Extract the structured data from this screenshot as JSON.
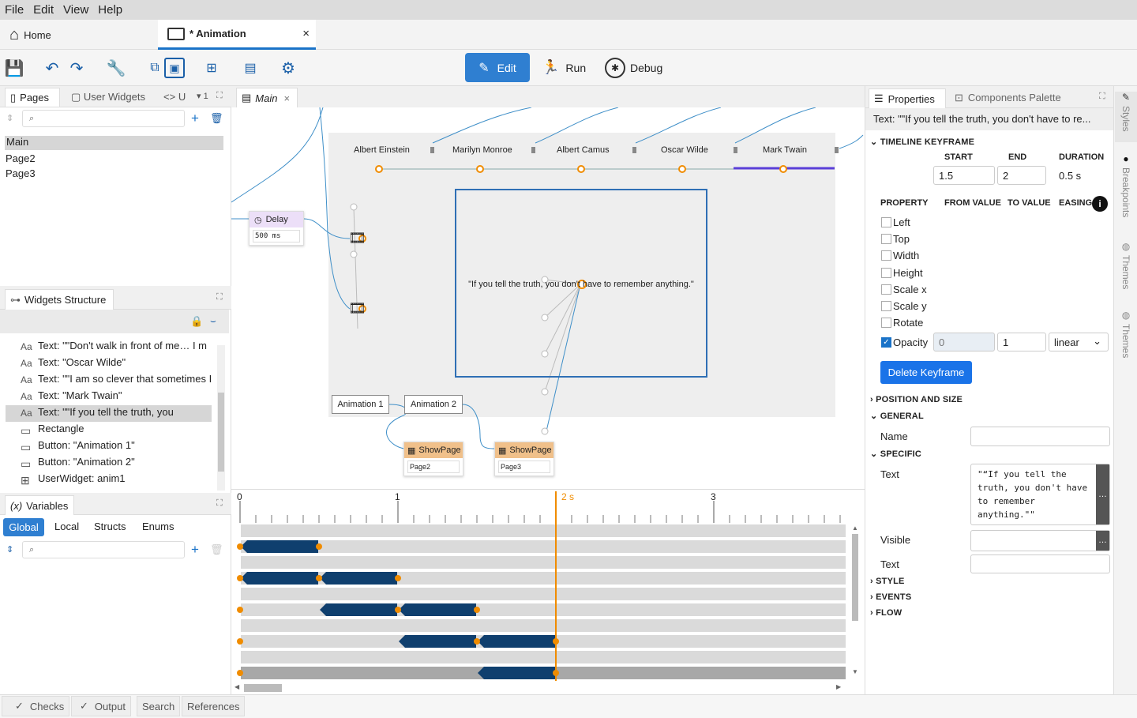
{
  "menu": [
    "File",
    "Edit",
    "View",
    "Help"
  ],
  "tabs": {
    "home": "Home",
    "animation": "* Animation"
  },
  "toolbar": {
    "edit": "Edit",
    "run": "Run",
    "debug": "Debug"
  },
  "left": {
    "pages_tab": "Pages",
    "user_widgets_tab": "User Widgets",
    "u_tab": "U",
    "count": "1",
    "pages": [
      "Main",
      "Page2",
      "Page3"
    ],
    "widgets_title": "Widgets Structure",
    "widgets": [
      "Text: \"\"Don't walk in front of me… I m",
      "Text: \"Oscar Wilde\"",
      "Text: \"\"I am so clever that sometimes I",
      "Text: \"Mark Twain\"",
      "Text: \"\"If you tell the truth, you",
      "Rectangle",
      "Button: \"Animation 1\"",
      "Button: \"Animation 2\"",
      "UserWidget: anim1"
    ],
    "variables_title": "Variables",
    "var_tabs": [
      "Global",
      "Local",
      "Structs",
      "Enums"
    ]
  },
  "center": {
    "tab": "Main",
    "names": [
      "Albert Einstein",
      "Marilyn Monroe",
      "Albert Camus",
      "Oscar Wilde",
      "Mark Twain"
    ],
    "quote": "\"If you tell the truth, you don't have to remember anything.\"",
    "delay": "Delay",
    "delay_val": "500 ms",
    "anim1": "Animation 1",
    "anim2": "Animation 2",
    "showpage": "ShowPage",
    "page2": "Page2",
    "page3": "Page3"
  },
  "timeline": {
    "ticks": [
      "0",
      "1",
      "2 s",
      "3"
    ],
    "playhead": 2
  },
  "right": {
    "props_tab": "Properties",
    "palette_tab": "Components Palette",
    "selected": "Text: \"\"If you tell the truth, you don't have to re...",
    "timeline_keyframe": "TIMELINE KEYFRAME",
    "start_lbl": "START",
    "end_lbl": "END",
    "duration_lbl": "DURATION",
    "start": "1.5",
    "end": "2",
    "duration": "0.5 s",
    "property_lbl": "PROPERTY",
    "from_lbl": "FROM VALUE",
    "to_lbl": "TO VALUE",
    "easing_lbl": "EASING",
    "props": [
      "Left",
      "Top",
      "Width",
      "Height",
      "Scale x",
      "Scale y",
      "Rotate"
    ],
    "opacity": "Opacity",
    "from": "0",
    "to": "1",
    "easing": "linear",
    "delete": "Delete Keyframe",
    "position_size": "POSITION AND SIZE",
    "general": "GENERAL",
    "name_lbl": "Name",
    "specific": "SPECIFIC",
    "text_lbl": "Text",
    "text_val": "\"“If you tell the truth, you don't have to remember anything.\"\"",
    "visible_lbl": "Visible",
    "text2_lbl": "Text",
    "style": "STYLE",
    "events": "EVENTS",
    "flow": "FLOW"
  },
  "side_tabs": [
    "Styles",
    "Breakpoints",
    "Themes",
    "Themes"
  ],
  "bottom_tabs": [
    "Checks",
    "Output",
    "Search",
    "References"
  ]
}
